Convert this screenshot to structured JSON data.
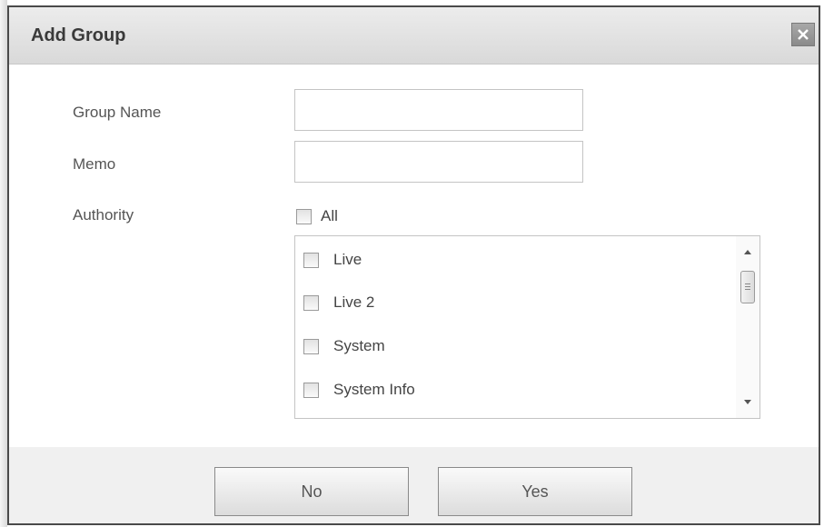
{
  "dialog": {
    "title": "Add Group",
    "close_icon": "close-icon"
  },
  "form": {
    "group_name": {
      "label": "Group Name",
      "value": "",
      "placeholder": ""
    },
    "memo": {
      "label": "Memo",
      "value": "",
      "placeholder": ""
    },
    "authority": {
      "label": "Authority",
      "all_label": "All",
      "all_checked": false,
      "items": [
        {
          "label": "Live",
          "checked": false
        },
        {
          "label": "Live 2",
          "checked": false
        },
        {
          "label": "System",
          "checked": false
        },
        {
          "label": "System Info",
          "checked": false
        }
      ]
    }
  },
  "buttons": {
    "no_label": "No",
    "yes_label": "Yes"
  },
  "colors": {
    "titlebar": "#e3e3e3",
    "close_button": "#999999",
    "footer": "#f0f0f0",
    "border": "#4a4a4a"
  }
}
